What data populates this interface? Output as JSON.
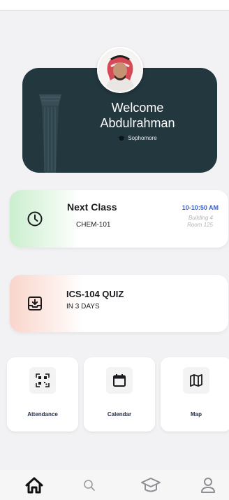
{
  "hero": {
    "welcome": "Welcome",
    "name": "Abdulrahman",
    "level": "Sophomore"
  },
  "next_class": {
    "title": "Next Class",
    "course": "CHEM-101",
    "time": "10-10:50 AM",
    "building": "Building 4",
    "room": "Room 125"
  },
  "quiz": {
    "title": "ICS-104 QUIZ",
    "due": "IN 3 DAYS"
  },
  "tiles": [
    {
      "label": "Attendance",
      "icon": "qr-code-icon"
    },
    {
      "label": "Calendar",
      "icon": "calendar-icon"
    },
    {
      "label": "Map",
      "icon": "map-icon"
    }
  ],
  "nav": [
    "home-icon",
    "search-icon",
    "graduation-cap-icon",
    "profile-icon"
  ],
  "colors": {
    "hero_bg": "#23373f",
    "accent_blue": "#3a5fcd",
    "next_glow": "#c4eec7",
    "quiz_glow": "#fad2c6",
    "background": "#f2f2f4"
  }
}
